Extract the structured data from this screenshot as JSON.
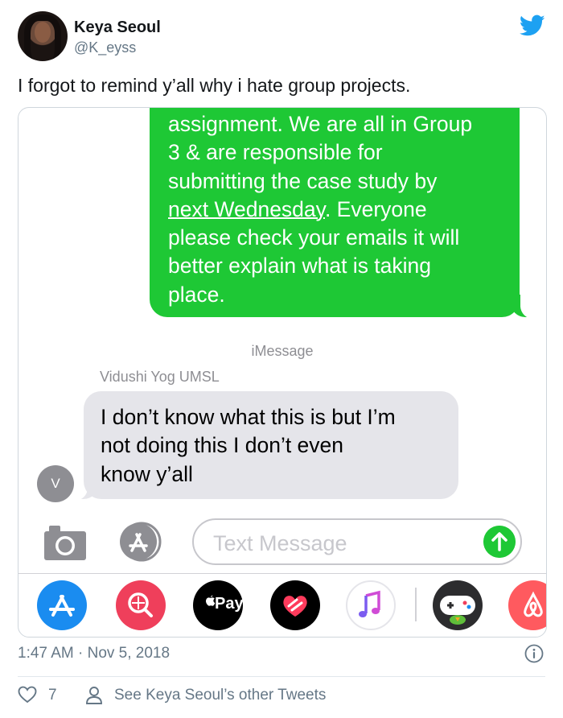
{
  "tweet": {
    "display_name": "Keya Seoul",
    "handle": "@K_eyss",
    "text": "I forgot to remind y’all why i hate group projects.",
    "timestamp": "1:47 AM · Nov 5, 2018",
    "like_count": "7",
    "other_tweets_link": "See Keya Seoul’s other Tweets"
  },
  "conversation": {
    "sent_message_lines": [
      "assignment. We are all in Group",
      "3 & are responsible for",
      "submitting the case study by",
      "next Wednesday",
      ". Everyone",
      "please check your emails it will",
      "better explain what is taking",
      "place."
    ],
    "service_label": "iMessage",
    "sender_name": "Vidushi Yog UMSL",
    "received_message_lines": [
      "I don’t know what this is but I’m",
      "not doing this I don’t even",
      "know y’all"
    ],
    "sender_initial": "V"
  },
  "composer": {
    "placeholder": "Text Message",
    "apple_pay_label": "Pay"
  },
  "icons": {
    "twitter": "twitter-bird-icon",
    "camera": "camera-icon",
    "appstore": "appstore-icon",
    "send": "send-arrow-icon",
    "info": "info-icon",
    "like": "heart-icon",
    "profile": "person-icon"
  },
  "colors": {
    "imessage_green": "#1ec835",
    "received_gray": "#e5e5ea",
    "twitter_blue": "#1da1f2",
    "secondary_text": "#657786"
  }
}
